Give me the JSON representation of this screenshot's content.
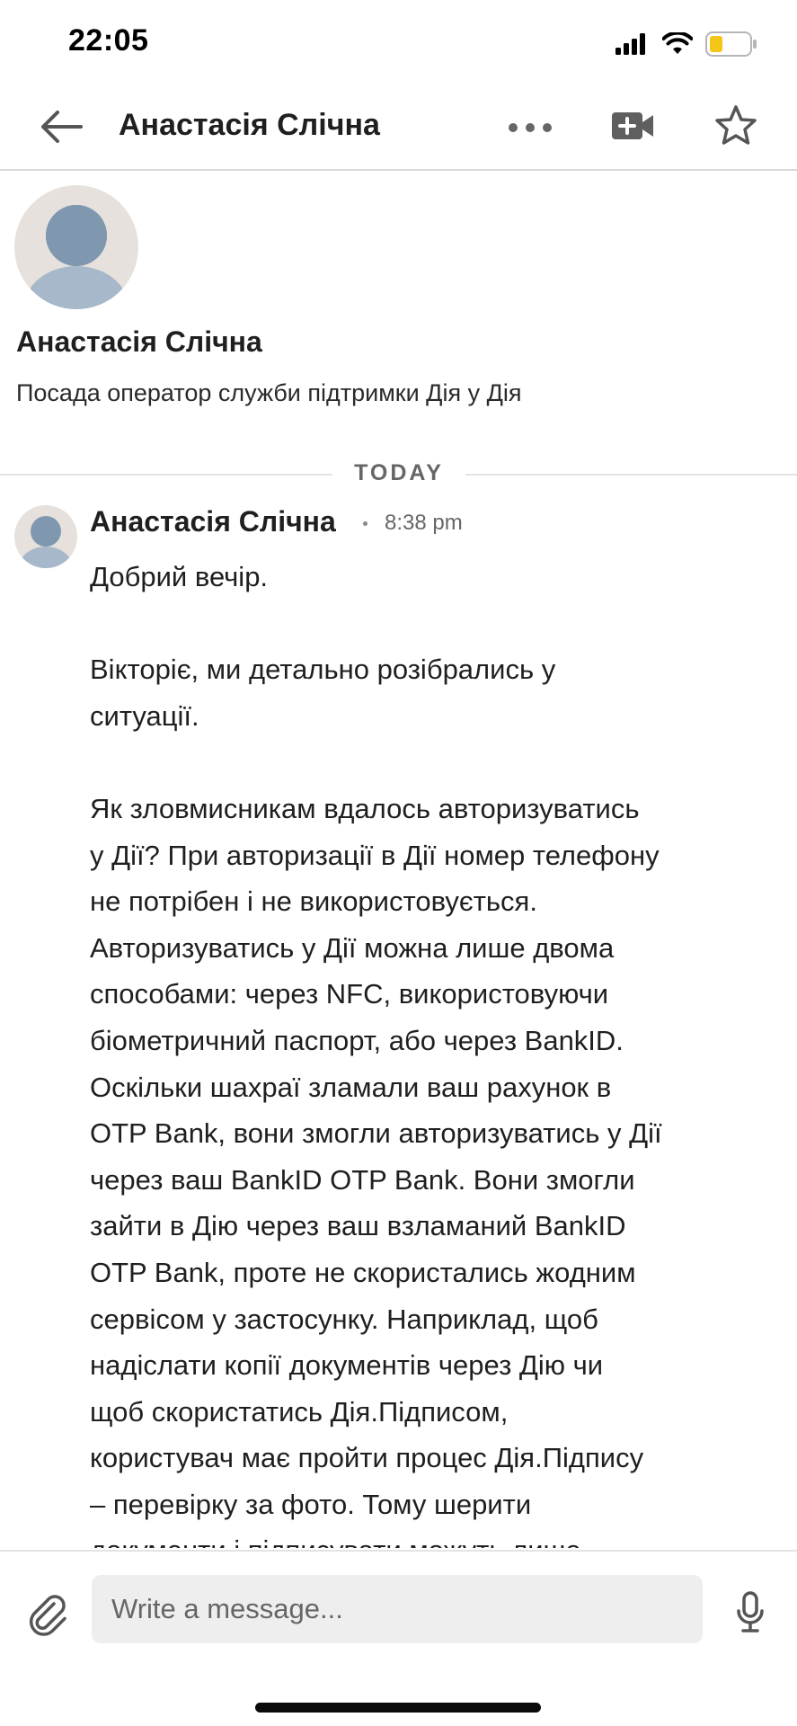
{
  "status_bar": {
    "time": "22:05",
    "icons": [
      "cellular-signal-icon",
      "wifi-icon",
      "battery-icon"
    ],
    "battery_color": "#f5c518"
  },
  "header": {
    "back_icon": "arrow-left-icon",
    "title": "Анастасія Слічна",
    "more_icon": "more-horizontal-icon",
    "video_icon": "video-add-icon",
    "star_icon": "star-outline-icon"
  },
  "profile": {
    "name": "Анастасія Слічна",
    "headline": "Посада оператор служби підтримки Дія у Дія",
    "avatar_icon": "default-avatar-icon"
  },
  "divider": {
    "label": "TODAY"
  },
  "message": {
    "sender": "Анастасія Слічна",
    "time": "8:38 pm",
    "paragraphs": [
      {
        "lines": [
          "Добрий вечір."
        ]
      },
      {
        "lines": [
          "Вікторіє, ми детально розібрались у",
          "ситуації."
        ]
      },
      {
        "lines": [
          "Як зловмисникам вдалось авторизуватись",
          "у Дії? При авторизації в Дії номер телефону",
          "не потрібен і не використовується.",
          "Авторизуватись у Дії можна лише двома",
          "способами: через NFC, використовуючи",
          "біометричний паспорт, або через BankID.",
          "Оскільки шахраї зламали ваш рахунок в",
          "OTP Bank, вони змогли авторизуватись у Дії",
          "через ваш BankID OTP Bank. Вони змогли",
          "зайти в Дію через ваш взламаний BankID",
          "OTP Bank, проте не скористались жодним",
          "сервісом у застосунку. Наприклад, щоб",
          "надіслати копії документів через Дію чи",
          "щоб скористатись Дія.Підписом,",
          "користувач має пройти процес Дія.Підпису",
          "– перевірку за фото. Тому шерити",
          "документи і підписувати можуть лише"
        ]
      }
    ]
  },
  "composer": {
    "attach_icon": "paperclip-icon",
    "placeholder": "Write a message...",
    "mic_icon": "microphone-icon"
  },
  "colors": {
    "avatar_bg": "#e6e1dc",
    "avatar_figure": "#7f98b0",
    "divider_line": "#e3e3e3",
    "input_bg": "#eeeeee"
  }
}
